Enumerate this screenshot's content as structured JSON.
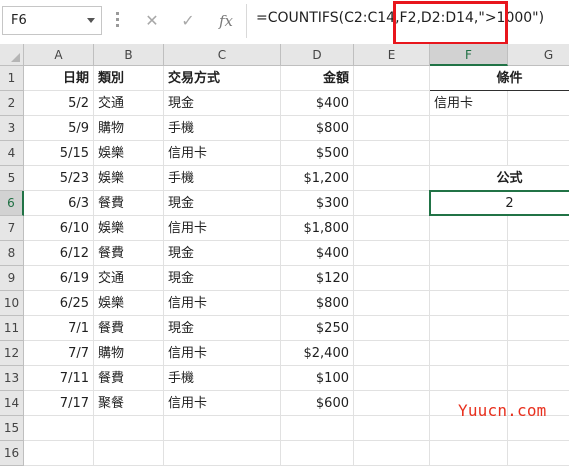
{
  "formula_bar": {
    "name_box": "F6",
    "cancel_icon": "✕",
    "enter_icon": "✓",
    "function_icon": "fx",
    "formula": "=COUNTIFS(C2:C14,F2,D2:D14,\">1000\")"
  },
  "sheet": {
    "columns": [
      "A",
      "B",
      "C",
      "D",
      "E",
      "F",
      "G"
    ],
    "selected_column": "F",
    "selected_row": 6,
    "rows": [
      {
        "n": "1",
        "a": "日期",
        "b": "類別",
        "c": "交易方式",
        "d": "金額",
        "f": "條件"
      },
      {
        "n": "2",
        "a": "5/2",
        "b": "交通",
        "c": "現金",
        "d": "$400",
        "f": "信用卡"
      },
      {
        "n": "3",
        "a": "5/9",
        "b": "購物",
        "c": "手機",
        "d": "$800",
        "f": ""
      },
      {
        "n": "4",
        "a": "5/15",
        "b": "娛樂",
        "c": "信用卡",
        "d": "$500",
        "f": ""
      },
      {
        "n": "5",
        "a": "5/23",
        "b": "娛樂",
        "c": "手機",
        "d": "$1,200",
        "f": "公式"
      },
      {
        "n": "6",
        "a": "6/3",
        "b": "餐費",
        "c": "現金",
        "d": "$300",
        "f": "2"
      },
      {
        "n": "7",
        "a": "6/10",
        "b": "娛樂",
        "c": "信用卡",
        "d": "$1,800",
        "f": ""
      },
      {
        "n": "8",
        "a": "6/12",
        "b": "餐費",
        "c": "現金",
        "d": "$400",
        "f": ""
      },
      {
        "n": "9",
        "a": "6/19",
        "b": "交通",
        "c": "現金",
        "d": "$120",
        "f": ""
      },
      {
        "n": "10",
        "a": "6/25",
        "b": "娛樂",
        "c": "信用卡",
        "d": "$800",
        "f": ""
      },
      {
        "n": "11",
        "a": "7/1",
        "b": "餐費",
        "c": "現金",
        "d": "$250",
        "f": ""
      },
      {
        "n": "12",
        "a": "7/7",
        "b": "購物",
        "c": "信用卡",
        "d": "$2,400",
        "f": ""
      },
      {
        "n": "13",
        "a": "7/11",
        "b": "餐費",
        "c": "手機",
        "d": "$100",
        "f": ""
      },
      {
        "n": "14",
        "a": "7/17",
        "b": "聚餐",
        "c": "信用卡",
        "d": "$600",
        "f": ""
      },
      {
        "n": "15",
        "a": "",
        "b": "",
        "c": "",
        "d": "",
        "f": ""
      },
      {
        "n": "16",
        "a": "",
        "b": "",
        "c": "",
        "d": "",
        "f": ""
      }
    ]
  },
  "watermark": "Yuucn.com",
  "colors": {
    "selection_green": "#217346",
    "highlight_red": "#e8161d",
    "watermark_red": "#e8301e",
    "header_gray": "#e6e6e6"
  }
}
